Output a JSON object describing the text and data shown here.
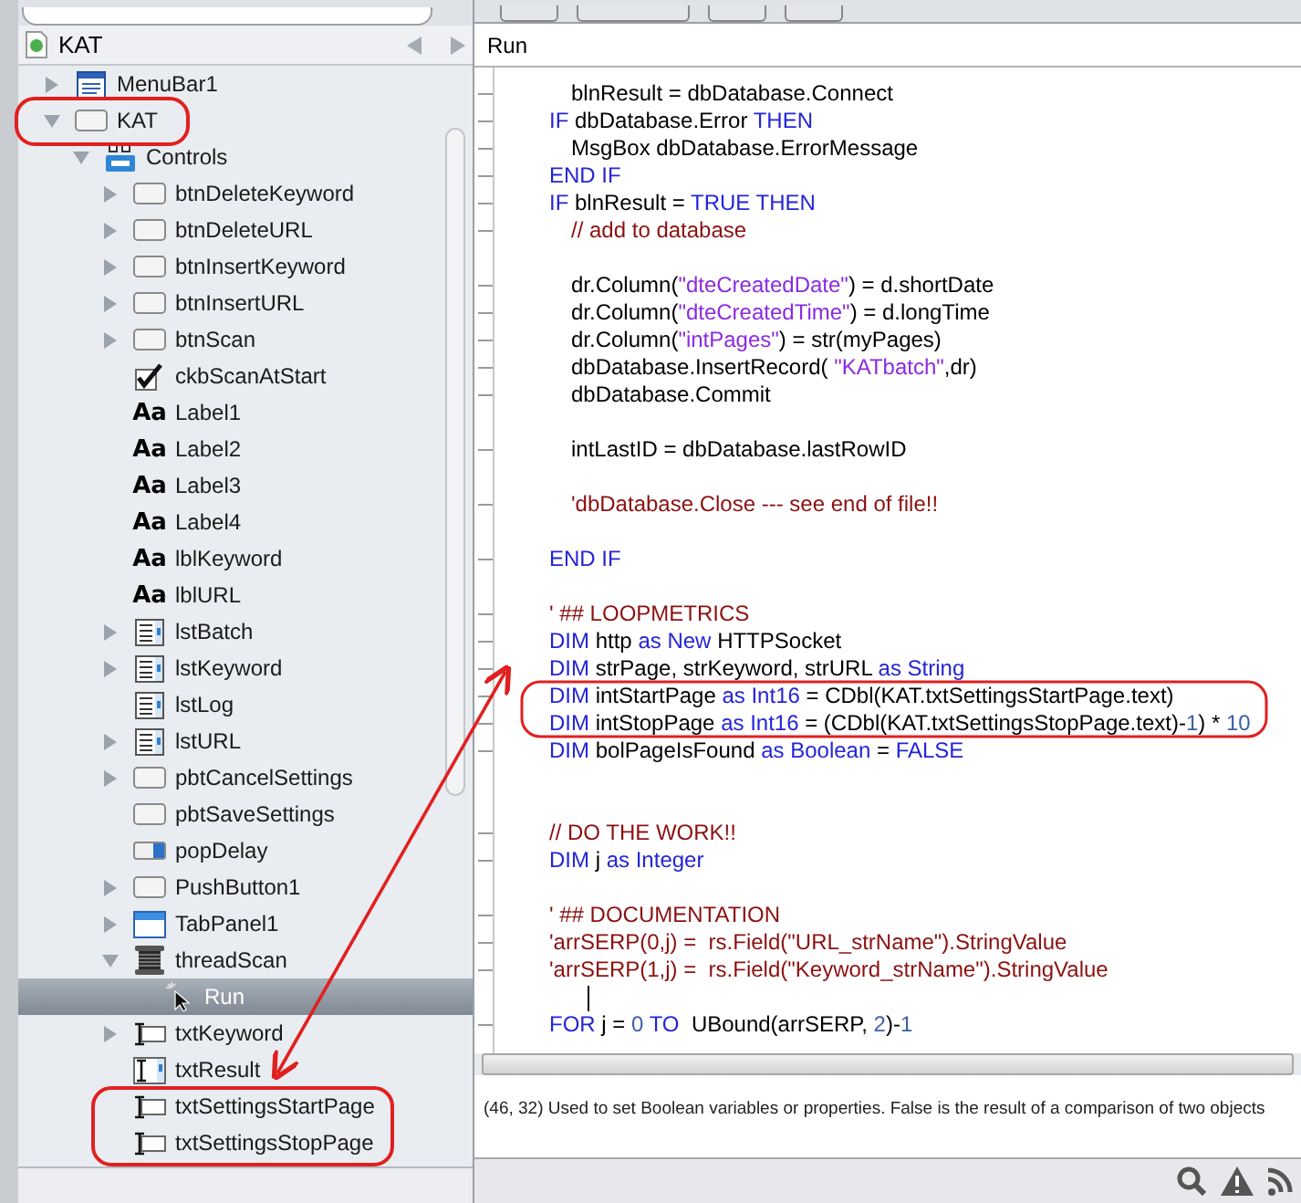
{
  "navigator": {
    "title": "KAT",
    "tree": [
      {
        "label": "MenuBar1",
        "kind": "menubar",
        "expanded": false,
        "selected": false
      },
      {
        "label": "KAT",
        "kind": "window",
        "expanded": true,
        "selected": false,
        "children": [
          {
            "label": "Controls",
            "kind": "controls",
            "expanded": true,
            "selected": false,
            "children": [
              {
                "label": "btnDeleteKeyword",
                "kind": "button",
                "expanded": false,
                "selected": false
              },
              {
                "label": "btnDeleteURL",
                "kind": "button",
                "expanded": false,
                "selected": false
              },
              {
                "label": "btnInsertKeyword",
                "kind": "button",
                "expanded": false,
                "selected": false
              },
              {
                "label": "btnInsertURL",
                "kind": "button",
                "expanded": false,
                "selected": false
              },
              {
                "label": "btnScan",
                "kind": "button",
                "expanded": false,
                "selected": false
              },
              {
                "label": "ckbScanAtStart",
                "kind": "checkbox",
                "selected": false
              },
              {
                "label": "Label1",
                "kind": "label",
                "icon_text": "Aa",
                "selected": false
              },
              {
                "label": "Label2",
                "kind": "label",
                "icon_text": "Aa",
                "selected": false
              },
              {
                "label": "Label3",
                "kind": "label",
                "icon_text": "Aa",
                "selected": false
              },
              {
                "label": "Label4",
                "kind": "label",
                "icon_text": "Aa",
                "selected": false
              },
              {
                "label": "lblKeyword",
                "kind": "label",
                "icon_text": "Aa",
                "selected": false
              },
              {
                "label": "lblURL",
                "kind": "label",
                "icon_text": "Aa",
                "selected": false
              },
              {
                "label": "lstBatch",
                "kind": "listbox",
                "expanded": false,
                "selected": false
              },
              {
                "label": "lstKeyword",
                "kind": "listbox",
                "expanded": false,
                "selected": false
              },
              {
                "label": "lstLog",
                "kind": "listbox",
                "selected": false
              },
              {
                "label": "lstURL",
                "kind": "listbox",
                "expanded": false,
                "selected": false
              },
              {
                "label": "pbtCancelSettings",
                "kind": "button",
                "expanded": false,
                "selected": false
              },
              {
                "label": "pbtSaveSettings",
                "kind": "button",
                "selected": false
              },
              {
                "label": "popDelay",
                "kind": "popup",
                "selected": false
              },
              {
                "label": "PushButton1",
                "kind": "button",
                "expanded": false,
                "selected": false
              },
              {
                "label": "TabPanel1",
                "kind": "tabpanel",
                "expanded": false,
                "selected": false
              },
              {
                "label": "threadScan",
                "kind": "thread",
                "expanded": true,
                "selected": false,
                "children": [
                  {
                    "label": "Run",
                    "kind": "event",
                    "selected": true
                  }
                ]
              },
              {
                "label": "txtKeyword",
                "kind": "textfield",
                "expanded": false,
                "selected": false
              },
              {
                "label": "txtResult",
                "kind": "textarea",
                "selected": false
              },
              {
                "label": "txtSettingsStartPage",
                "kind": "textfield",
                "selected": false
              },
              {
                "label": "txtSettingsStopPage",
                "kind": "textfield",
                "selected": false
              }
            ]
          }
        ]
      }
    ]
  },
  "editor": {
    "title": "Run",
    "lines": [
      {
        "kind": "code",
        "indented": true,
        "tokens": [
          {
            "kind": "plain",
            "text": "blnResult = dbDatabase.Connect"
          }
        ]
      },
      {
        "kind": "code",
        "indented": false,
        "tokens": [
          {
            "kind": "keyword",
            "text": "IF "
          },
          {
            "kind": "plain",
            "text": "dbDatabase.Error "
          },
          {
            "kind": "keyword",
            "text": "THEN"
          }
        ]
      },
      {
        "kind": "code",
        "indented": true,
        "tokens": [
          {
            "kind": "plain",
            "text": "MsgBox dbDatabase.ErrorMessage"
          }
        ]
      },
      {
        "kind": "code",
        "indented": false,
        "tokens": [
          {
            "kind": "keyword",
            "text": "END IF"
          }
        ]
      },
      {
        "kind": "code",
        "indented": false,
        "tokens": [
          {
            "kind": "keyword",
            "text": "IF "
          },
          {
            "kind": "plain",
            "text": "blnResult = "
          },
          {
            "kind": "keyword",
            "text": "TRUE THEN"
          }
        ]
      },
      {
        "kind": "code",
        "indented": true,
        "tokens": [
          {
            "kind": "comment",
            "text": "// add to database"
          }
        ]
      },
      {
        "kind": "blank"
      },
      {
        "kind": "code",
        "indented": true,
        "tokens": [
          {
            "kind": "plain",
            "text": "dr.Column("
          },
          {
            "kind": "string",
            "text": "\"dteCreatedDate\""
          },
          {
            "kind": "plain",
            "text": ") = d.shortDate"
          }
        ]
      },
      {
        "kind": "code",
        "indented": true,
        "tokens": [
          {
            "kind": "plain",
            "text": "dr.Column("
          },
          {
            "kind": "string",
            "text": "\"dteCreatedTime\""
          },
          {
            "kind": "plain",
            "text": ") = d.longTime"
          }
        ]
      },
      {
        "kind": "code",
        "indented": true,
        "tokens": [
          {
            "kind": "plain",
            "text": "dr.Column("
          },
          {
            "kind": "string",
            "text": "\"intPages\""
          },
          {
            "kind": "plain",
            "text": ") = str(myPages)"
          }
        ]
      },
      {
        "kind": "code",
        "indented": true,
        "tokens": [
          {
            "kind": "plain",
            "text": "dbDatabase.InsertRecord( "
          },
          {
            "kind": "string",
            "text": "\"KATbatch\""
          },
          {
            "kind": "plain",
            "text": ",dr)"
          }
        ]
      },
      {
        "kind": "code",
        "indented": true,
        "tokens": [
          {
            "kind": "plain",
            "text": "dbDatabase.Commit"
          }
        ]
      },
      {
        "kind": "blank"
      },
      {
        "kind": "code",
        "indented": true,
        "tokens": [
          {
            "kind": "plain",
            "text": "intLastID = dbDatabase.lastRowID"
          }
        ]
      },
      {
        "kind": "blank"
      },
      {
        "kind": "code",
        "indented": true,
        "tokens": [
          {
            "kind": "comment",
            "text": "'dbDatabase.Close --- see end of file!!"
          }
        ]
      },
      {
        "kind": "blank"
      },
      {
        "kind": "code",
        "indented": false,
        "tokens": [
          {
            "kind": "keyword",
            "text": "END IF"
          }
        ]
      },
      {
        "kind": "blank"
      },
      {
        "kind": "code",
        "indented": false,
        "tokens": [
          {
            "kind": "comment",
            "text": "' ## LOOPMETRICS"
          }
        ]
      },
      {
        "kind": "code",
        "indented": false,
        "tokens": [
          {
            "kind": "keyword",
            "text": "DIM "
          },
          {
            "kind": "plain",
            "text": "http "
          },
          {
            "kind": "keyword",
            "text": "as New "
          },
          {
            "kind": "plain",
            "text": "HTTPSocket"
          }
        ]
      },
      {
        "kind": "code",
        "indented": false,
        "tokens": [
          {
            "kind": "keyword",
            "text": "DIM "
          },
          {
            "kind": "plain",
            "text": "strPage, strKeyword, strURL "
          },
          {
            "kind": "keyword",
            "text": "as String"
          }
        ]
      },
      {
        "kind": "code",
        "indented": false,
        "tokens": [
          {
            "kind": "keyword",
            "text": "DIM "
          },
          {
            "kind": "plain",
            "text": "intStartPage "
          },
          {
            "kind": "keyword",
            "text": "as Int16 "
          },
          {
            "kind": "plain",
            "text": "= CDbl(KAT.txtSettingsStartPage.text)"
          }
        ]
      },
      {
        "kind": "code",
        "indented": false,
        "tokens": [
          {
            "kind": "keyword",
            "text": "DIM "
          },
          {
            "kind": "plain",
            "text": "intStopPage "
          },
          {
            "kind": "keyword",
            "text": "as Int16 "
          },
          {
            "kind": "plain",
            "text": "= (CDbl(KAT.txtSettingsStopPage.text)-"
          },
          {
            "kind": "number",
            "text": "1"
          },
          {
            "kind": "plain",
            "text": ") * "
          },
          {
            "kind": "number",
            "text": "10"
          }
        ]
      },
      {
        "kind": "code",
        "indented": false,
        "tokens": [
          {
            "kind": "keyword",
            "text": "DIM "
          },
          {
            "kind": "plain",
            "text": "bolPageIsFound "
          },
          {
            "kind": "keyword",
            "text": "as Boolean "
          },
          {
            "kind": "plain",
            "text": "= "
          },
          {
            "kind": "keyword",
            "text": "FALSE"
          }
        ]
      },
      {
        "kind": "blank"
      },
      {
        "kind": "blank"
      },
      {
        "kind": "code",
        "indented": false,
        "tokens": [
          {
            "kind": "comment",
            "text": "// DO THE WORK!!"
          }
        ]
      },
      {
        "kind": "code",
        "indented": false,
        "tokens": [
          {
            "kind": "keyword",
            "text": "DIM "
          },
          {
            "kind": "plain",
            "text": "j "
          },
          {
            "kind": "keyword",
            "text": "as Integer"
          }
        ]
      },
      {
        "kind": "blank"
      },
      {
        "kind": "code",
        "indented": false,
        "tokens": [
          {
            "kind": "comment",
            "text": "' ## DOCUMENTATION"
          }
        ]
      },
      {
        "kind": "code",
        "indented": false,
        "tokens": [
          {
            "kind": "comment",
            "text": "'arrSERP(0,j) =  rs.Field(\"URL_strName\").StringValue"
          }
        ]
      },
      {
        "kind": "code",
        "indented": false,
        "tokens": [
          {
            "kind": "comment",
            "text": "'arrSERP(1,j) =  rs.Field(\"Keyword_strName\").StringValue"
          }
        ]
      },
      {
        "kind": "cursor"
      },
      {
        "kind": "code",
        "indented": false,
        "tokens": [
          {
            "kind": "keyword",
            "text": "FOR "
          },
          {
            "kind": "plain",
            "text": "j = "
          },
          {
            "kind": "number",
            "text": "0"
          },
          {
            "kind": "keyword",
            "text": " TO  "
          },
          {
            "kind": "plain",
            "text": "UBound(arrSERP, "
          },
          {
            "kind": "number",
            "text": "2"
          },
          {
            "kind": "plain",
            "text": ")-"
          },
          {
            "kind": "number",
            "text": "1"
          }
        ]
      }
    ],
    "status": "(46, 32) Used to set Boolean variables or properties. False is the result of a comparison of two objects"
  }
}
